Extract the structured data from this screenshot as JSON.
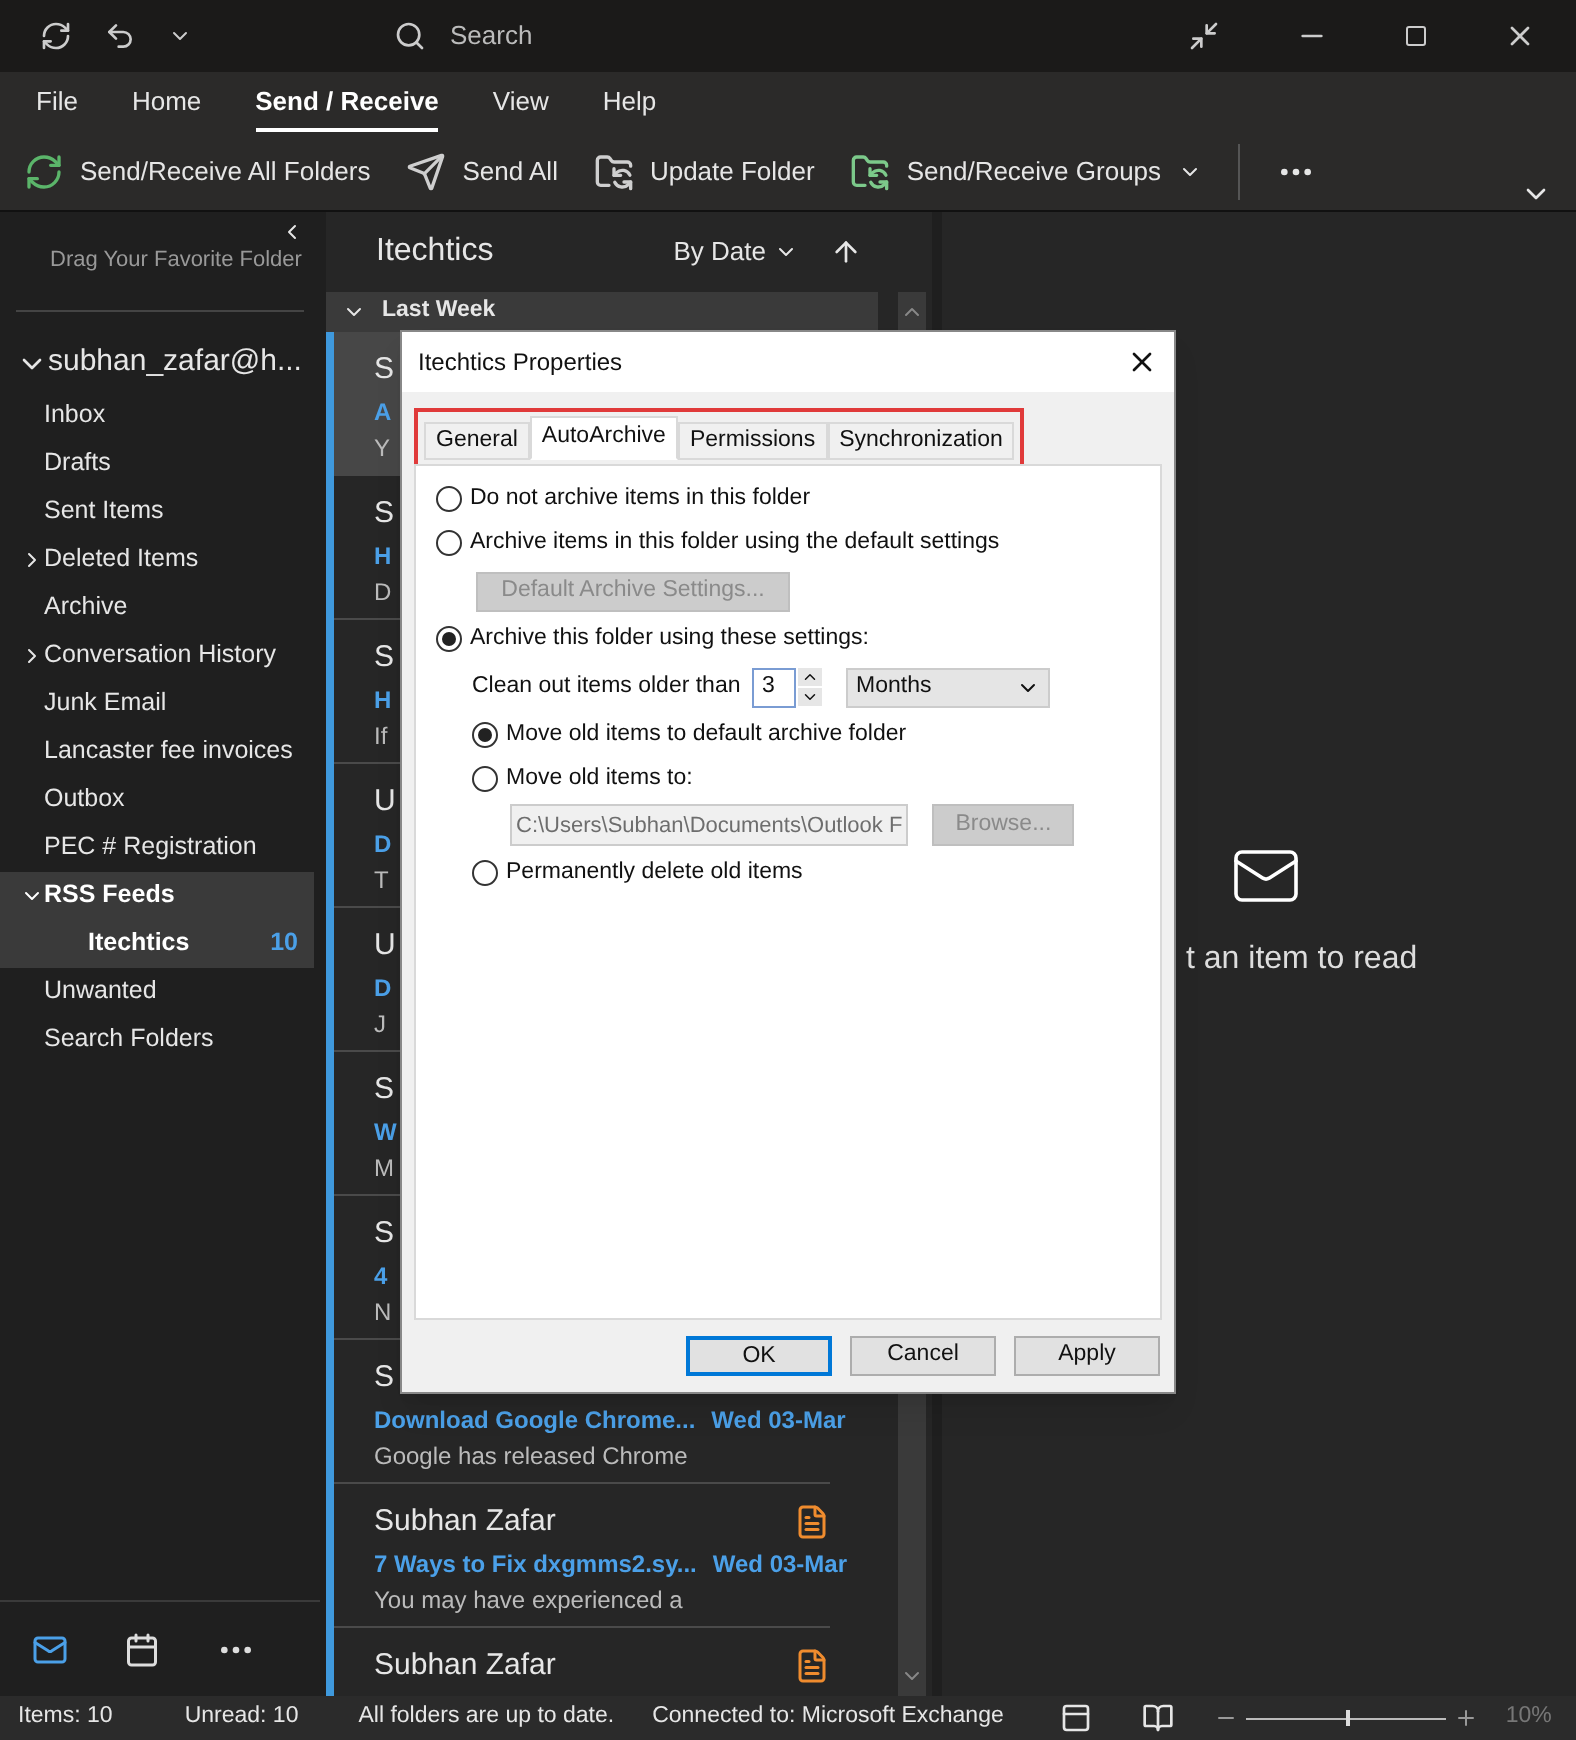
{
  "search": {
    "placeholder": "Search"
  },
  "ribbon_tabs": [
    {
      "label": "File",
      "selected": false
    },
    {
      "label": "Home",
      "selected": false
    },
    {
      "label": "Send / Receive",
      "selected": true
    },
    {
      "label": "View",
      "selected": false
    },
    {
      "label": "Help",
      "selected": false
    }
  ],
  "toolbar": [
    {
      "label": "Send/Receive All Folders",
      "kind": "sync"
    },
    {
      "label": "Send All",
      "kind": "send"
    },
    {
      "label": "Update Folder",
      "kind": "folder"
    },
    {
      "label": "Send/Receive Groups",
      "kind": "groups"
    }
  ],
  "folder_pane": {
    "hint": "Drag Your Favorite Folder",
    "account": {
      "label": "subhan_zafar@h...",
      "expanded": true,
      "children": [
        {
          "label": "Inbox",
          "selected": false
        },
        {
          "label": "Drafts",
          "selected": false
        },
        {
          "label": "Sent Items",
          "selected": false
        },
        {
          "label": "Deleted Items",
          "selected": false,
          "expanded": false
        },
        {
          "label": "Archive",
          "selected": false
        },
        {
          "label": "Conversation History",
          "selected": false,
          "expanded": false
        },
        {
          "label": "Junk Email",
          "selected": false
        },
        {
          "label": "Lancaster fee invoices",
          "selected": false
        },
        {
          "label": "Outbox",
          "selected": false
        },
        {
          "label": "PEC # Registration",
          "selected": false
        },
        {
          "label": "RSS Feeds",
          "selected": false,
          "expanded": true,
          "children": [
            {
              "label": "Itechtics",
              "selected": true,
              "count": "10"
            }
          ]
        },
        {
          "label": "Unwanted",
          "selected": false
        },
        {
          "label": "Search Folders",
          "selected": false
        }
      ]
    }
  },
  "nav": [
    {
      "kind": "mail",
      "selected": true
    },
    {
      "kind": "calendar",
      "selected": false
    },
    {
      "kind": "more",
      "selected": false
    }
  ],
  "message_list": {
    "title": "Itechtics",
    "sort": "By Date",
    "group": {
      "label": "Last Week",
      "expanded": true
    },
    "items": [
      {
        "sender": "S",
        "subject": "A",
        "preview": "Y",
        "selected": true
      },
      {
        "sender": "S",
        "subject": "H",
        "preview": "D",
        "selected": false
      },
      {
        "sender": "S",
        "subject": "H",
        "preview": "If",
        "selected": false
      },
      {
        "sender": "U",
        "subject": "D",
        "preview": "T",
        "selected": false
      },
      {
        "sender": "U",
        "subject": "D",
        "preview": "J",
        "selected": false
      },
      {
        "sender": "S",
        "subject": "W",
        "preview": "M",
        "selected": false
      },
      {
        "sender": "S",
        "subject": "4",
        "preview": "N",
        "selected": false
      },
      {
        "sender": "S",
        "subject": "Download Google Chrome...",
        "date": "Wed 03-Mar",
        "preview": "Google has released Chrome",
        "selected": false
      },
      {
        "sender": "Subhan Zafar",
        "subject": "7 Ways to Fix dxgmms2.sy...",
        "date": "Wed 03-Mar",
        "preview": "You may have experienced a",
        "selected": false,
        "rss": true
      },
      {
        "sender": "Subhan Zafar",
        "selected": false,
        "rss": true
      }
    ]
  },
  "reading_pane": {
    "message": "t an item to read"
  },
  "dialog": {
    "title": "Itechtics Properties",
    "highlight_tabs": true,
    "tabs": [
      {
        "label": "General",
        "selected": false
      },
      {
        "label": "AutoArchive",
        "selected": true
      },
      {
        "label": "Permissions",
        "selected": false
      },
      {
        "label": "Synchronization",
        "selected": false
      }
    ],
    "options": [
      {
        "label": "Do not archive items in this folder",
        "selected": false
      },
      {
        "label": "Archive items in this folder using the default settings",
        "selected": false,
        "button": {
          "label": "Default Archive Settings...",
          "disabled": true
        }
      },
      {
        "label": "Archive this folder using these settings:",
        "selected": true
      }
    ],
    "clean_out": {
      "label": "Clean out items older than",
      "value": "3",
      "unit": "Months"
    },
    "move_options": [
      {
        "label": "Move old items to default archive folder",
        "selected": true
      },
      {
        "label": "Move old items to:",
        "selected": false,
        "path": "C:\\Users\\Subhan\\Documents\\Outlook F",
        "browse": "Browse...",
        "disabled": true
      },
      {
        "label": "Permanently delete old items",
        "selected": false
      }
    ],
    "buttons": [
      {
        "label": "OK",
        "default": true
      },
      {
        "label": "Cancel",
        "default": false
      },
      {
        "label": "Apply",
        "default": false
      }
    ]
  },
  "status_bar": {
    "items": "Items: 10",
    "unread": "Unread: 10",
    "sync": "All folders are up to date.",
    "connection": "Connected to: Microsoft Exchange",
    "zoom": "10%",
    "level": 0.5
  }
}
